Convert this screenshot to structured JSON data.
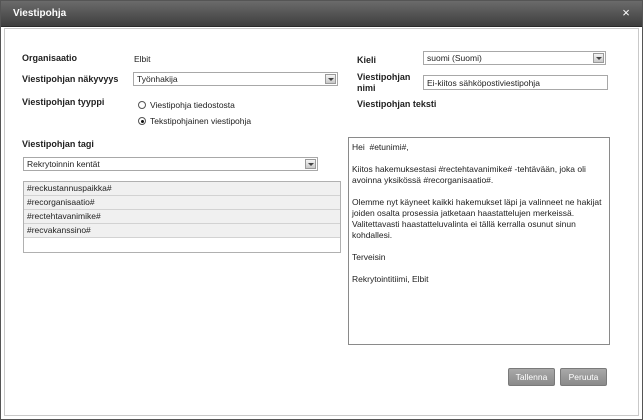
{
  "window": {
    "title": "Viestipohja",
    "close_symbol": "×"
  },
  "form": {
    "organization": {
      "label": "Organisaatio",
      "value": "Elbit"
    },
    "visibility": {
      "label": "Viestipohjan näkyvyys",
      "value": "Työnhakija"
    },
    "type": {
      "label": "Viestipohjan tyyppi",
      "options": [
        {
          "label": "Viestipohja tiedostosta",
          "checked": false
        },
        {
          "label": "Tekstipohjainen viestipohja",
          "checked": true
        }
      ]
    },
    "tag": {
      "label": "Viestipohjan tagi",
      "select_value": "Rekrytoinnin kentät",
      "items": [
        "#reckustannuspaikka#",
        "#recorganisaatio#",
        "#rectehtavanimike#",
        "#recvakanssino#"
      ]
    },
    "language": {
      "label": "Kieli",
      "value": "suomi (Suomi)"
    },
    "name": {
      "label": "Viestipohjan nimi",
      "value": "Ei-kiitos sähköpostiviestipohja"
    },
    "text": {
      "label": "Viestipohjan teksti",
      "paragraphs": [
        "Hei  #etunimi#,",
        "Kiitos hakemuksestasi #rectehtavanimike# -tehtävään, joka oli avoinna yksikössä #recorganisaatio#.",
        "Olemme nyt käyneet kaikki hakemukset läpi ja valinneet ne hakijat joiden osalta prosessia jatketaan haastattelujen merkeissä. Valitettavasti haastatteluvalinta ei tällä kerralla osunut sinun kohdallesi.",
        "Terveisin",
        "Rekrytointitiimi, Elbit"
      ]
    }
  },
  "buttons": {
    "save": "Tallenna",
    "cancel": "Peruuta"
  }
}
